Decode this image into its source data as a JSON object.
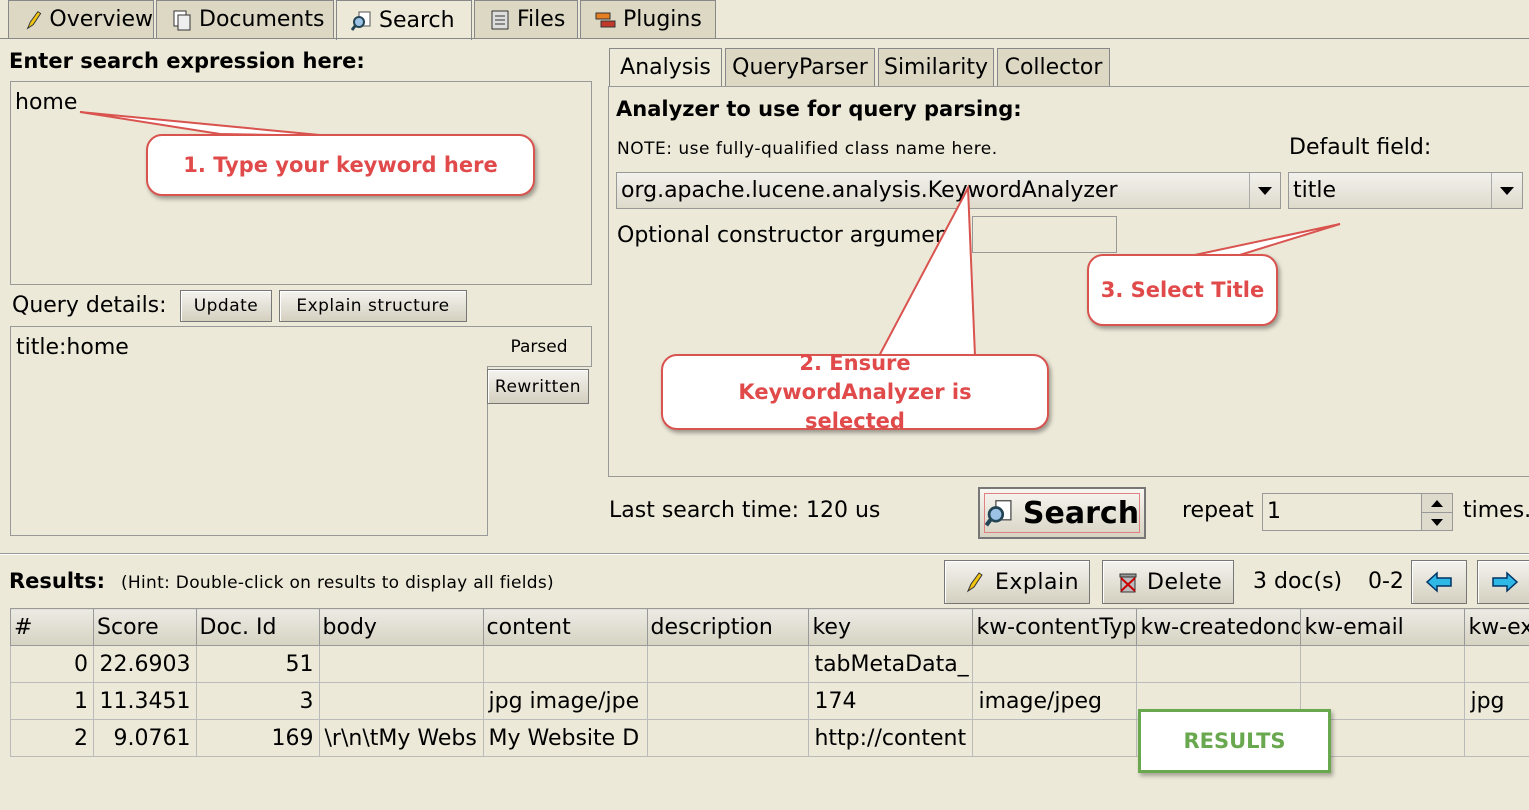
{
  "tabs": [
    {
      "label": "Overview",
      "icon": "pencil-icon"
    },
    {
      "label": "Documents",
      "icon": "documents-icon"
    },
    {
      "label": "Search",
      "icon": "search-icon"
    },
    {
      "label": "Files",
      "icon": "files-icon"
    },
    {
      "label": "Plugins",
      "icon": "plugins-icon"
    }
  ],
  "search_panel": {
    "heading": "Enter search expression here:",
    "expression": "home",
    "query_details_label": "Query details:",
    "update_label": "Update",
    "explain_structure_label": "Explain structure",
    "parsed_query": "title:home",
    "parsed_label": "Parsed",
    "rewritten_label": "Rewritten"
  },
  "analysis": {
    "subtabs": [
      "Analysis",
      "QueryParser",
      "Similarity",
      "Collector"
    ],
    "heading": "Analyzer to use for query parsing:",
    "note": "NOTE: use fully-qualified class name here.",
    "analyzer_value": "org.apache.lucene.analysis.KeywordAnalyzer",
    "default_field_label": "Default field:",
    "default_field_value": "title",
    "ctor_label": "Optional constructor argument",
    "ctor_value": ""
  },
  "search_bar": {
    "last_search_time": "Last search time: 120 us",
    "search_label": "Search",
    "repeat_label": "repeat",
    "repeat_value": "1",
    "times_label": "times."
  },
  "results": {
    "label": "Results:",
    "hint": "(Hint: Double-click on results to display all fields)",
    "explain_label": "Explain",
    "delete_label": "Delete",
    "doc_count": "3 doc(s)",
    "range": "0-2",
    "columns": [
      "#",
      "Score",
      "Doc. Id",
      "body",
      "content",
      "description",
      "key",
      "kw-contentTyp",
      "kw-createdond",
      "kw-email",
      "kw-exten"
    ],
    "rows": [
      [
        "0",
        "22.6903",
        "51",
        "",
        "",
        "",
        "tabMetaData_",
        "",
        "",
        "",
        ""
      ],
      [
        "1",
        "11.3451",
        "3",
        "",
        "jpg image/jpe",
        "",
        "174",
        "image/jpeg",
        "",
        "",
        "jpg"
      ],
      [
        "2",
        "9.0761",
        "169",
        "\\r\\n\\tMy Webs",
        "My Website D",
        "",
        "http://content",
        "",
        "",
        "",
        ""
      ]
    ]
  },
  "annotations": {
    "callout1": "1. Type your keyword here",
    "callout2": "2. Ensure KeywordAnalyzer is selected",
    "callout3": "3. Select Title",
    "results_box": "RESULTS"
  },
  "colors": {
    "background": "#ece9d8",
    "callout_text": "#e04a4a",
    "callout_border": "#d9534f",
    "results_green": "#6aa84f"
  }
}
